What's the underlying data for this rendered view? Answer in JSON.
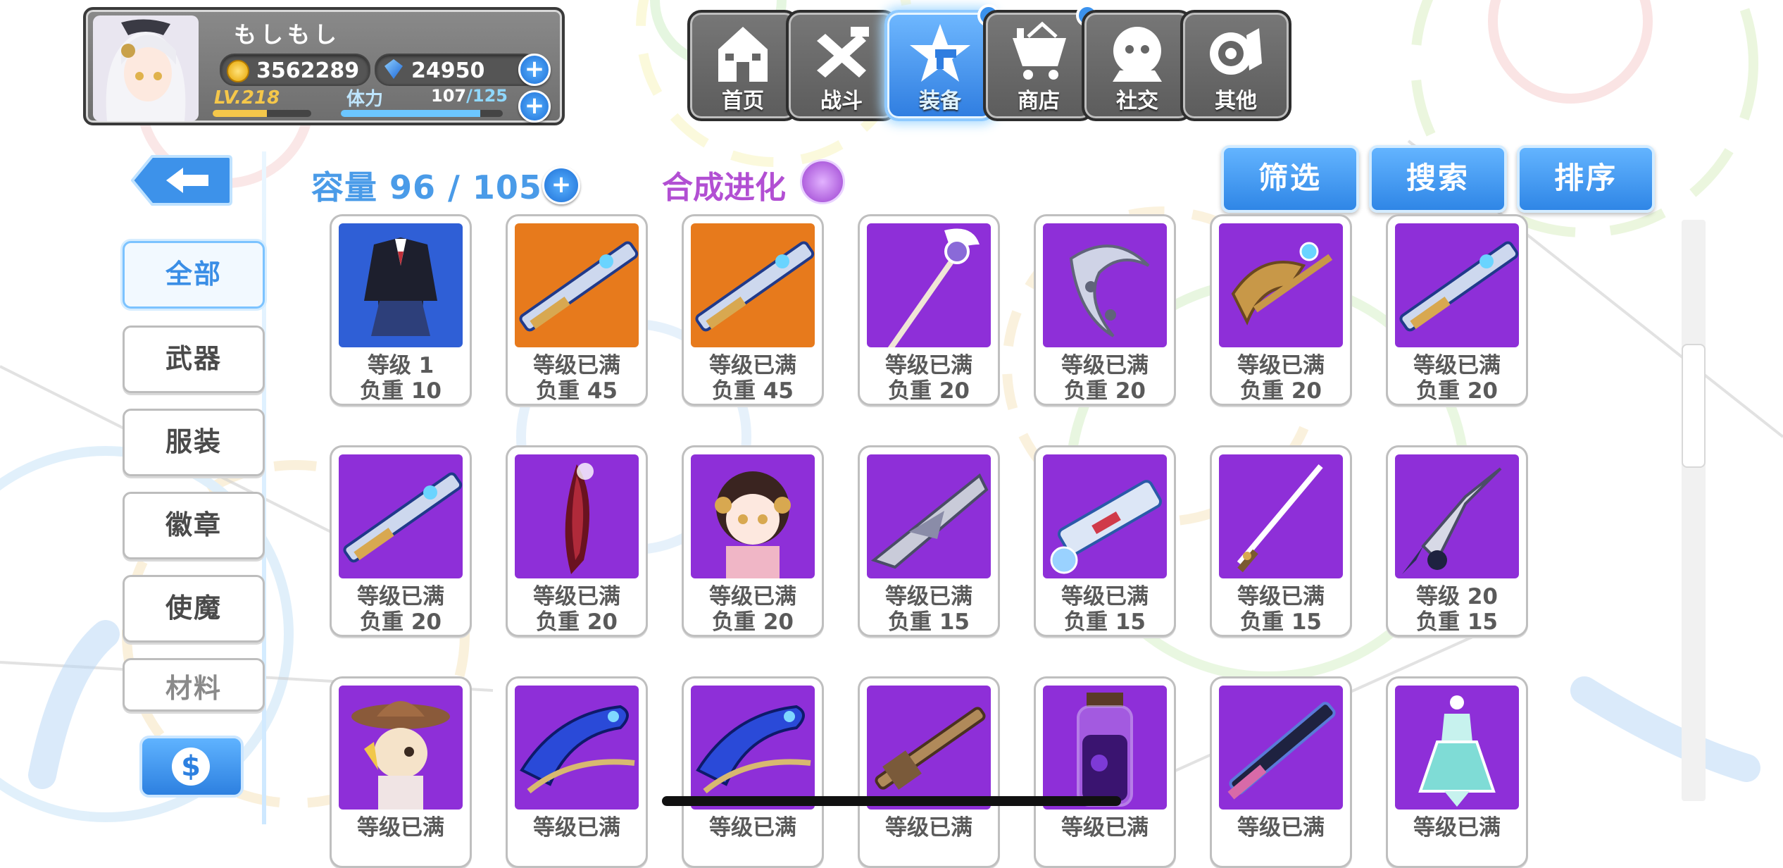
{
  "player": {
    "name": "もしもし",
    "coins": "3562289",
    "gems": "24950",
    "level": "LV.218",
    "level_progress": 0.55,
    "stamina_label": "体力",
    "stamina_current": "107",
    "stamina_max": "/125",
    "stamina_progress": 0.86
  },
  "nav": [
    {
      "label": "首页",
      "icon": "house-icon",
      "active": false,
      "badge": false
    },
    {
      "label": "战斗",
      "icon": "crossed-guns-icon",
      "active": false,
      "badge": false
    },
    {
      "label": "装备",
      "icon": "star-gun-icon",
      "active": true,
      "badge": true
    },
    {
      "label": "商店",
      "icon": "shop-basket-icon",
      "active": false,
      "badge": true
    },
    {
      "label": "社交",
      "icon": "social-face-icon",
      "active": false,
      "badge": false
    },
    {
      "label": "其他",
      "icon": "snail-other-icon",
      "active": false,
      "badge": false
    }
  ],
  "categories": [
    "全部",
    "武器",
    "服装",
    "徽章",
    "使魔",
    "材料"
  ],
  "active_category": "全部",
  "capacity_text": "容量 96 / 105",
  "synthesis_text": "合成进化",
  "actions": {
    "filter": "筛选",
    "search": "搜索",
    "sort": "排序"
  },
  "items": [
    {
      "level": "等级 1",
      "weight": "负重 10",
      "bg": "#2f5fd6",
      "art": "uniform-costume"
    },
    {
      "level": "等级已满",
      "weight": "负重 45",
      "bg": "#e77a1c",
      "art": "dark-rifle"
    },
    {
      "level": "等级已满",
      "weight": "负重 45",
      "bg": "#e77a1c",
      "art": "blue-gold-rifle"
    },
    {
      "level": "等级已满",
      "weight": "负重 20",
      "bg": "#8e2fd8",
      "art": "winged-staff"
    },
    {
      "level": "等级已满",
      "weight": "负重 20",
      "bg": "#8e2fd8",
      "art": "bone-claw"
    },
    {
      "level": "等级已满",
      "weight": "负重 20",
      "bg": "#8e2fd8",
      "art": "golden-crossbow"
    },
    {
      "level": "等级已满",
      "weight": "负重 20",
      "bg": "#8e2fd8",
      "art": "silver-rifle"
    },
    {
      "level": "等级已满",
      "weight": "负重 20",
      "bg": "#8e2fd8",
      "art": "silver-rifle-2"
    },
    {
      "level": "等级已满",
      "weight": "负重 20",
      "bg": "#8e2fd8",
      "art": "crimson-blade"
    },
    {
      "level": "等级已满",
      "weight": "负重 20",
      "bg": "#8e2fd8",
      "art": "chibi-girl-familiar"
    },
    {
      "level": "等级已满",
      "weight": "负重 15",
      "bg": "#8e2fd8",
      "art": "grey-scythe-gun"
    },
    {
      "level": "等级已满",
      "weight": "负重 15",
      "bg": "#8e2fd8",
      "art": "ice-launcher"
    },
    {
      "level": "等级已满",
      "weight": "负重 15",
      "bg": "#8e2fd8",
      "art": "katana"
    },
    {
      "level": "等级 20",
      "weight": "负重 15",
      "bg": "#8e2fd8",
      "art": "drill-lance"
    },
    {
      "level": "等级已满",
      "weight": "",
      "bg": "#8e2fd8",
      "art": "cowboy-familiar"
    },
    {
      "level": "等级已满",
      "weight": "",
      "bg": "#8e2fd8",
      "art": "blue-serpent-gun"
    },
    {
      "level": "等级已满",
      "weight": "",
      "bg": "#8e2fd8",
      "art": "blue-serpent-gun-2"
    },
    {
      "level": "等级已满",
      "weight": "",
      "bg": "#8e2fd8",
      "art": "bronze-rifle"
    },
    {
      "level": "等级已满",
      "weight": "",
      "bg": "#8e2fd8",
      "art": "potion-jar"
    },
    {
      "level": "等级已满",
      "weight": "",
      "bg": "#8e2fd8",
      "art": "dark-sniper"
    },
    {
      "level": "等级已满",
      "weight": "",
      "bg": "#8e2fd8",
      "art": "crystal-dress"
    }
  ],
  "colors": {
    "accent_blue": "#3a8ee6",
    "purple_accent": "#b24fd3",
    "item_purple": "#8e2fd8",
    "item_orange": "#e77a1c"
  }
}
